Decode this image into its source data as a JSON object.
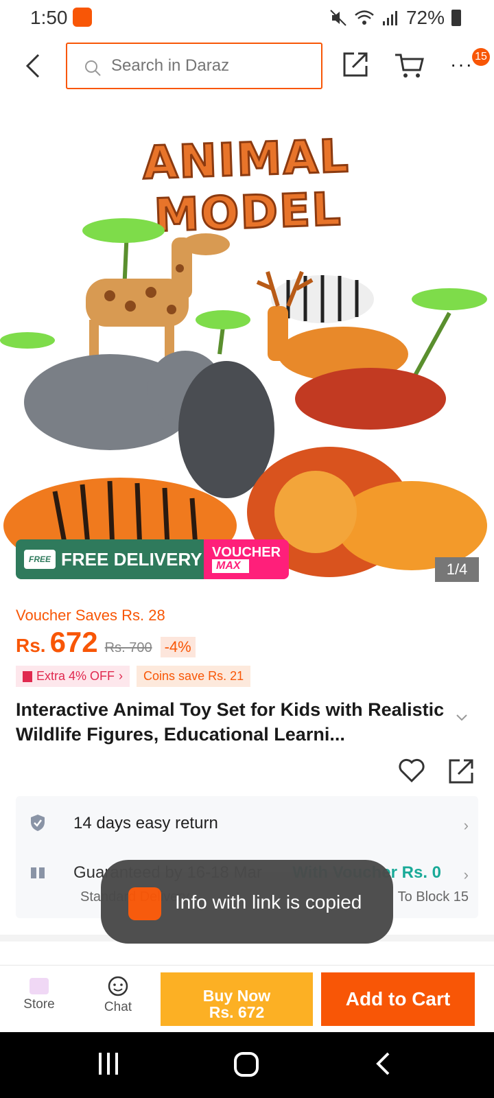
{
  "status_bar": {
    "time": "1:50",
    "battery": "72%"
  },
  "header": {
    "search_placeholder": "Search in Daraz",
    "cart_badge": "15",
    "more": "···"
  },
  "hero": {
    "title": "ANIMAL MODEL",
    "free_delivery": "FREE DELIVERY",
    "free_tag": "FREE",
    "voucher_label": "VOUCHER",
    "voucher_max": "MAX",
    "counter": "1/4"
  },
  "price": {
    "voucher_saves": "Voucher Saves Rs. 28",
    "currency": "Rs.",
    "value": "672",
    "original": "Rs. 700",
    "discount": "-4%",
    "extra_off": "Extra 4% OFF",
    "coins_save": "Coins save Rs. 21"
  },
  "product": {
    "title": "Interactive Animal Toy Set for Kids with Realistic Wildlife Figures, Educational Learni..."
  },
  "info": {
    "return_label": "14 days easy return",
    "guaranteed": "Guaranteed by 16-18 Mar",
    "voucher": "With Voucher Rs. 0",
    "standard": "Standard Delivery",
    "block": "To Block 15"
  },
  "toast": {
    "message": "Info with link is copied"
  },
  "bottom_bar": {
    "store_label": "Store",
    "chat_label": "Chat",
    "buy_now_line1": "Buy Now",
    "buy_now_line2": "Rs. 672",
    "add_to_cart": "Add to Cart"
  },
  "colors": {
    "accent": "#f85606",
    "buy_now": "#fcb024",
    "free_delivery": "#2f7a5c",
    "voucher": "#ff1f7a",
    "teal": "#1aaa98"
  }
}
